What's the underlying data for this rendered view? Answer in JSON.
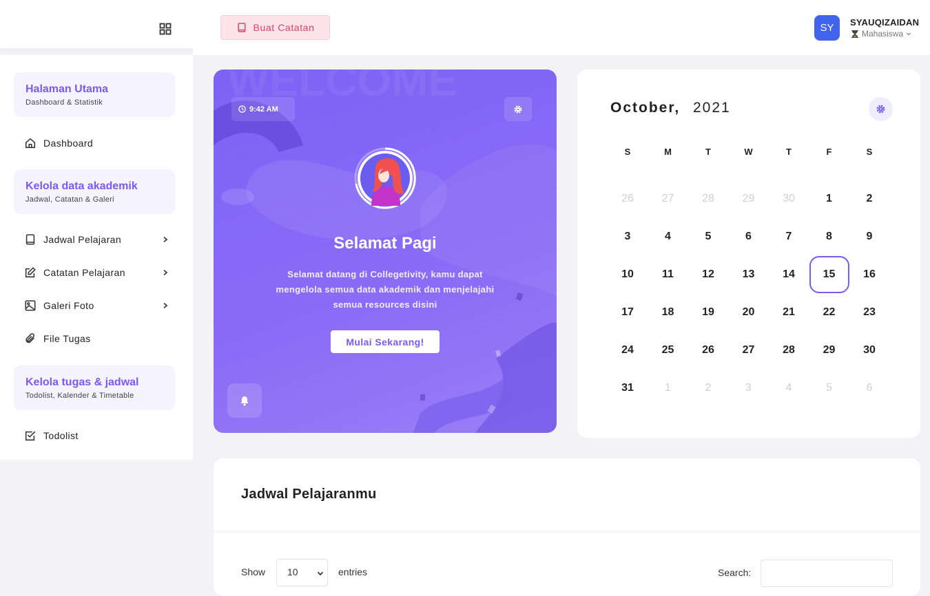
{
  "header": {
    "create_note_label": "Buat Catatan",
    "user": {
      "initials": "SY",
      "name": "SYAUQIZAIDAN",
      "role": "Mahasiswa"
    }
  },
  "sidebar": {
    "sections": [
      {
        "title": "Halaman Utama",
        "subtitle": "Dashboard & Statistik"
      },
      {
        "title": "Kelola data akademik",
        "subtitle": "Jadwal, Catatan & Galeri"
      },
      {
        "title": "Kelola tugas & jadwal",
        "subtitle": "Todolist, Kalender & Timetable"
      }
    ],
    "items": [
      {
        "label": "Dashboard"
      },
      {
        "label": "Jadwal Pelajaran"
      },
      {
        "label": "Catatan Pelajaran"
      },
      {
        "label": "Galeri Foto"
      },
      {
        "label": "File Tugas"
      },
      {
        "label": "Todolist"
      }
    ]
  },
  "welcome": {
    "time": "9:42 AM",
    "title": "Selamat Pagi",
    "message": "Selamat datang di Collegetivity, kamu dapat mengelola semua data akademik dan menjelajahi semua resources disini",
    "cta_label": "Mulai Sekarang!"
  },
  "calendar": {
    "month": "October,",
    "year": "2021",
    "weekdays": [
      "S",
      "M",
      "T",
      "W",
      "T",
      "F",
      "S"
    ],
    "weeks": [
      [
        "26",
        "27",
        "28",
        "29",
        "30",
        "1",
        "2"
      ],
      [
        "3",
        "4",
        "5",
        "6",
        "7",
        "8",
        "9"
      ],
      [
        "10",
        "11",
        "12",
        "13",
        "14",
        "15",
        "16"
      ],
      [
        "17",
        "18",
        "19",
        "20",
        "21",
        "22",
        "23"
      ],
      [
        "24",
        "25",
        "26",
        "27",
        "28",
        "29",
        "30"
      ],
      [
        "31",
        "1",
        "2",
        "3",
        "4",
        "5",
        "6"
      ]
    ],
    "selected": "15"
  },
  "schedule": {
    "title": "Jadwal Pelajaranmu",
    "show_label": "Show",
    "entries_value": "10",
    "entries_label": "entries",
    "search_label": "Search:"
  },
  "colors": {
    "accent": "#7a5af0",
    "avatar": "#4263eb",
    "note_button": "#e53d6a"
  }
}
